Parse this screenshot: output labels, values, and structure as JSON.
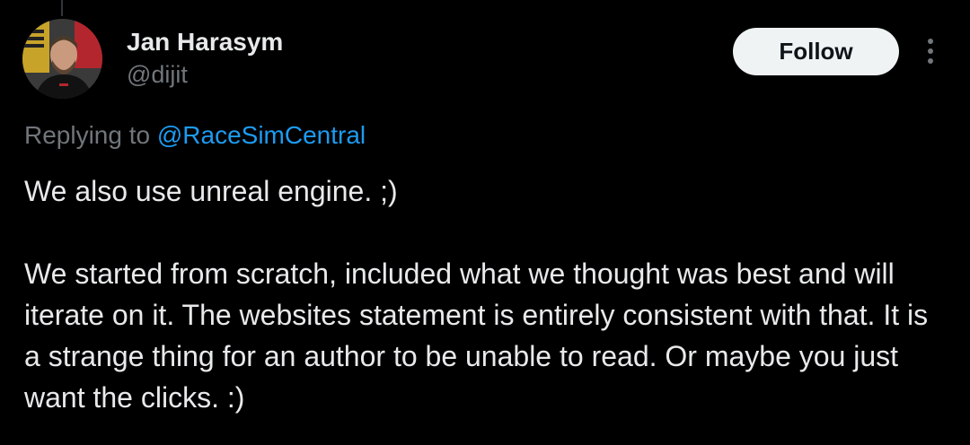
{
  "author": {
    "name": "Jan Harasym",
    "handle": "@dijit",
    "avatar_icon": "profile-photo"
  },
  "follow_button": {
    "label": "Follow"
  },
  "more_menu": {
    "icon": "more-vertical-icon"
  },
  "reply": {
    "prefix": "Replying to ",
    "mention": "@RaceSimCentral"
  },
  "tweet": {
    "paragraphs": [
      "We also use unreal engine. ;)",
      "We started from scratch, included what we thought was best and will iterate on it. The websites statement is entirely consistent with that. It is a strange thing for an author to be unable to read. Or maybe you just want the clicks. :)"
    ]
  },
  "colors": {
    "background": "#000000",
    "primary_text": "#e7e9ea",
    "secondary_text": "#71767b",
    "link": "#1d9bf0",
    "button_bg": "#eff3f4",
    "button_text": "#0f1419"
  }
}
